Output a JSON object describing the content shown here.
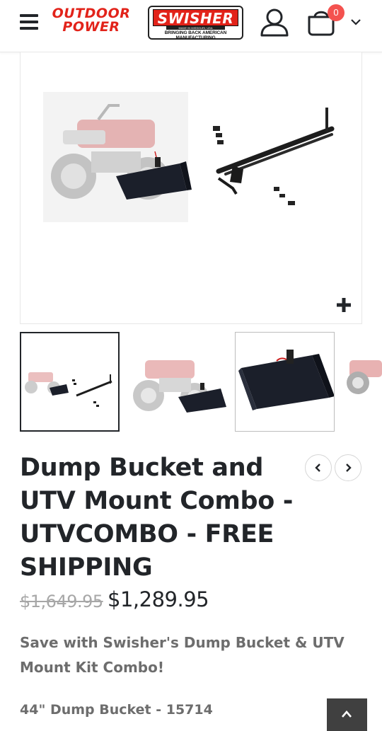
{
  "header": {
    "logo_outdoor_line1": "OUTDOOR",
    "logo_outdoor_line2": "POWER",
    "logo_swisher_main": "SWISHER",
    "logo_swisher_sub1": "MADE IN MISSOURI, USA",
    "logo_swisher_sub2": "BRINGING BACK AMERICAN MANUFACTURING",
    "cart_count": "0",
    "icons": {
      "menu": "hamburger-menu-icon",
      "user": "user-icon",
      "cart": "cart-icon",
      "dropdown": "chevron-down-icon"
    }
  },
  "gallery": {
    "main_image": "dump-bucket-and-utv-mount-combo",
    "zoom_icon": "plus-icon",
    "thumbnails": [
      {
        "subject": "combo-kit",
        "state": "active"
      },
      {
        "subject": "atv-with-bucket",
        "state": "normal"
      },
      {
        "subject": "dump-bucket",
        "state": "normal"
      },
      {
        "subject": "atv-side-view",
        "state": "partial"
      }
    ]
  },
  "product": {
    "title": "Dump Bucket and UTV Mount Combo - UTVCOMBO - FREE SHIPPING",
    "old_price": "$1,649.95",
    "new_price": "$1,289.95",
    "description": "Save with Swisher's Dump Bucket & UTV Mount Kit Combo!",
    "items": [
      "44\" Dump Bucket - 15714"
    ]
  },
  "nav": {
    "prev_icon": "chevron-left-icon",
    "next_icon": "chevron-right-icon"
  },
  "scroll_top_icon": "chevron-up-icon",
  "colors": {
    "brand_red": "#e2231a",
    "badge": "#f4524f",
    "text_dark": "#222529",
    "text_muted": "#6d6d6d",
    "old_price": "#a7a7a7",
    "scroll_button": "#404040"
  }
}
